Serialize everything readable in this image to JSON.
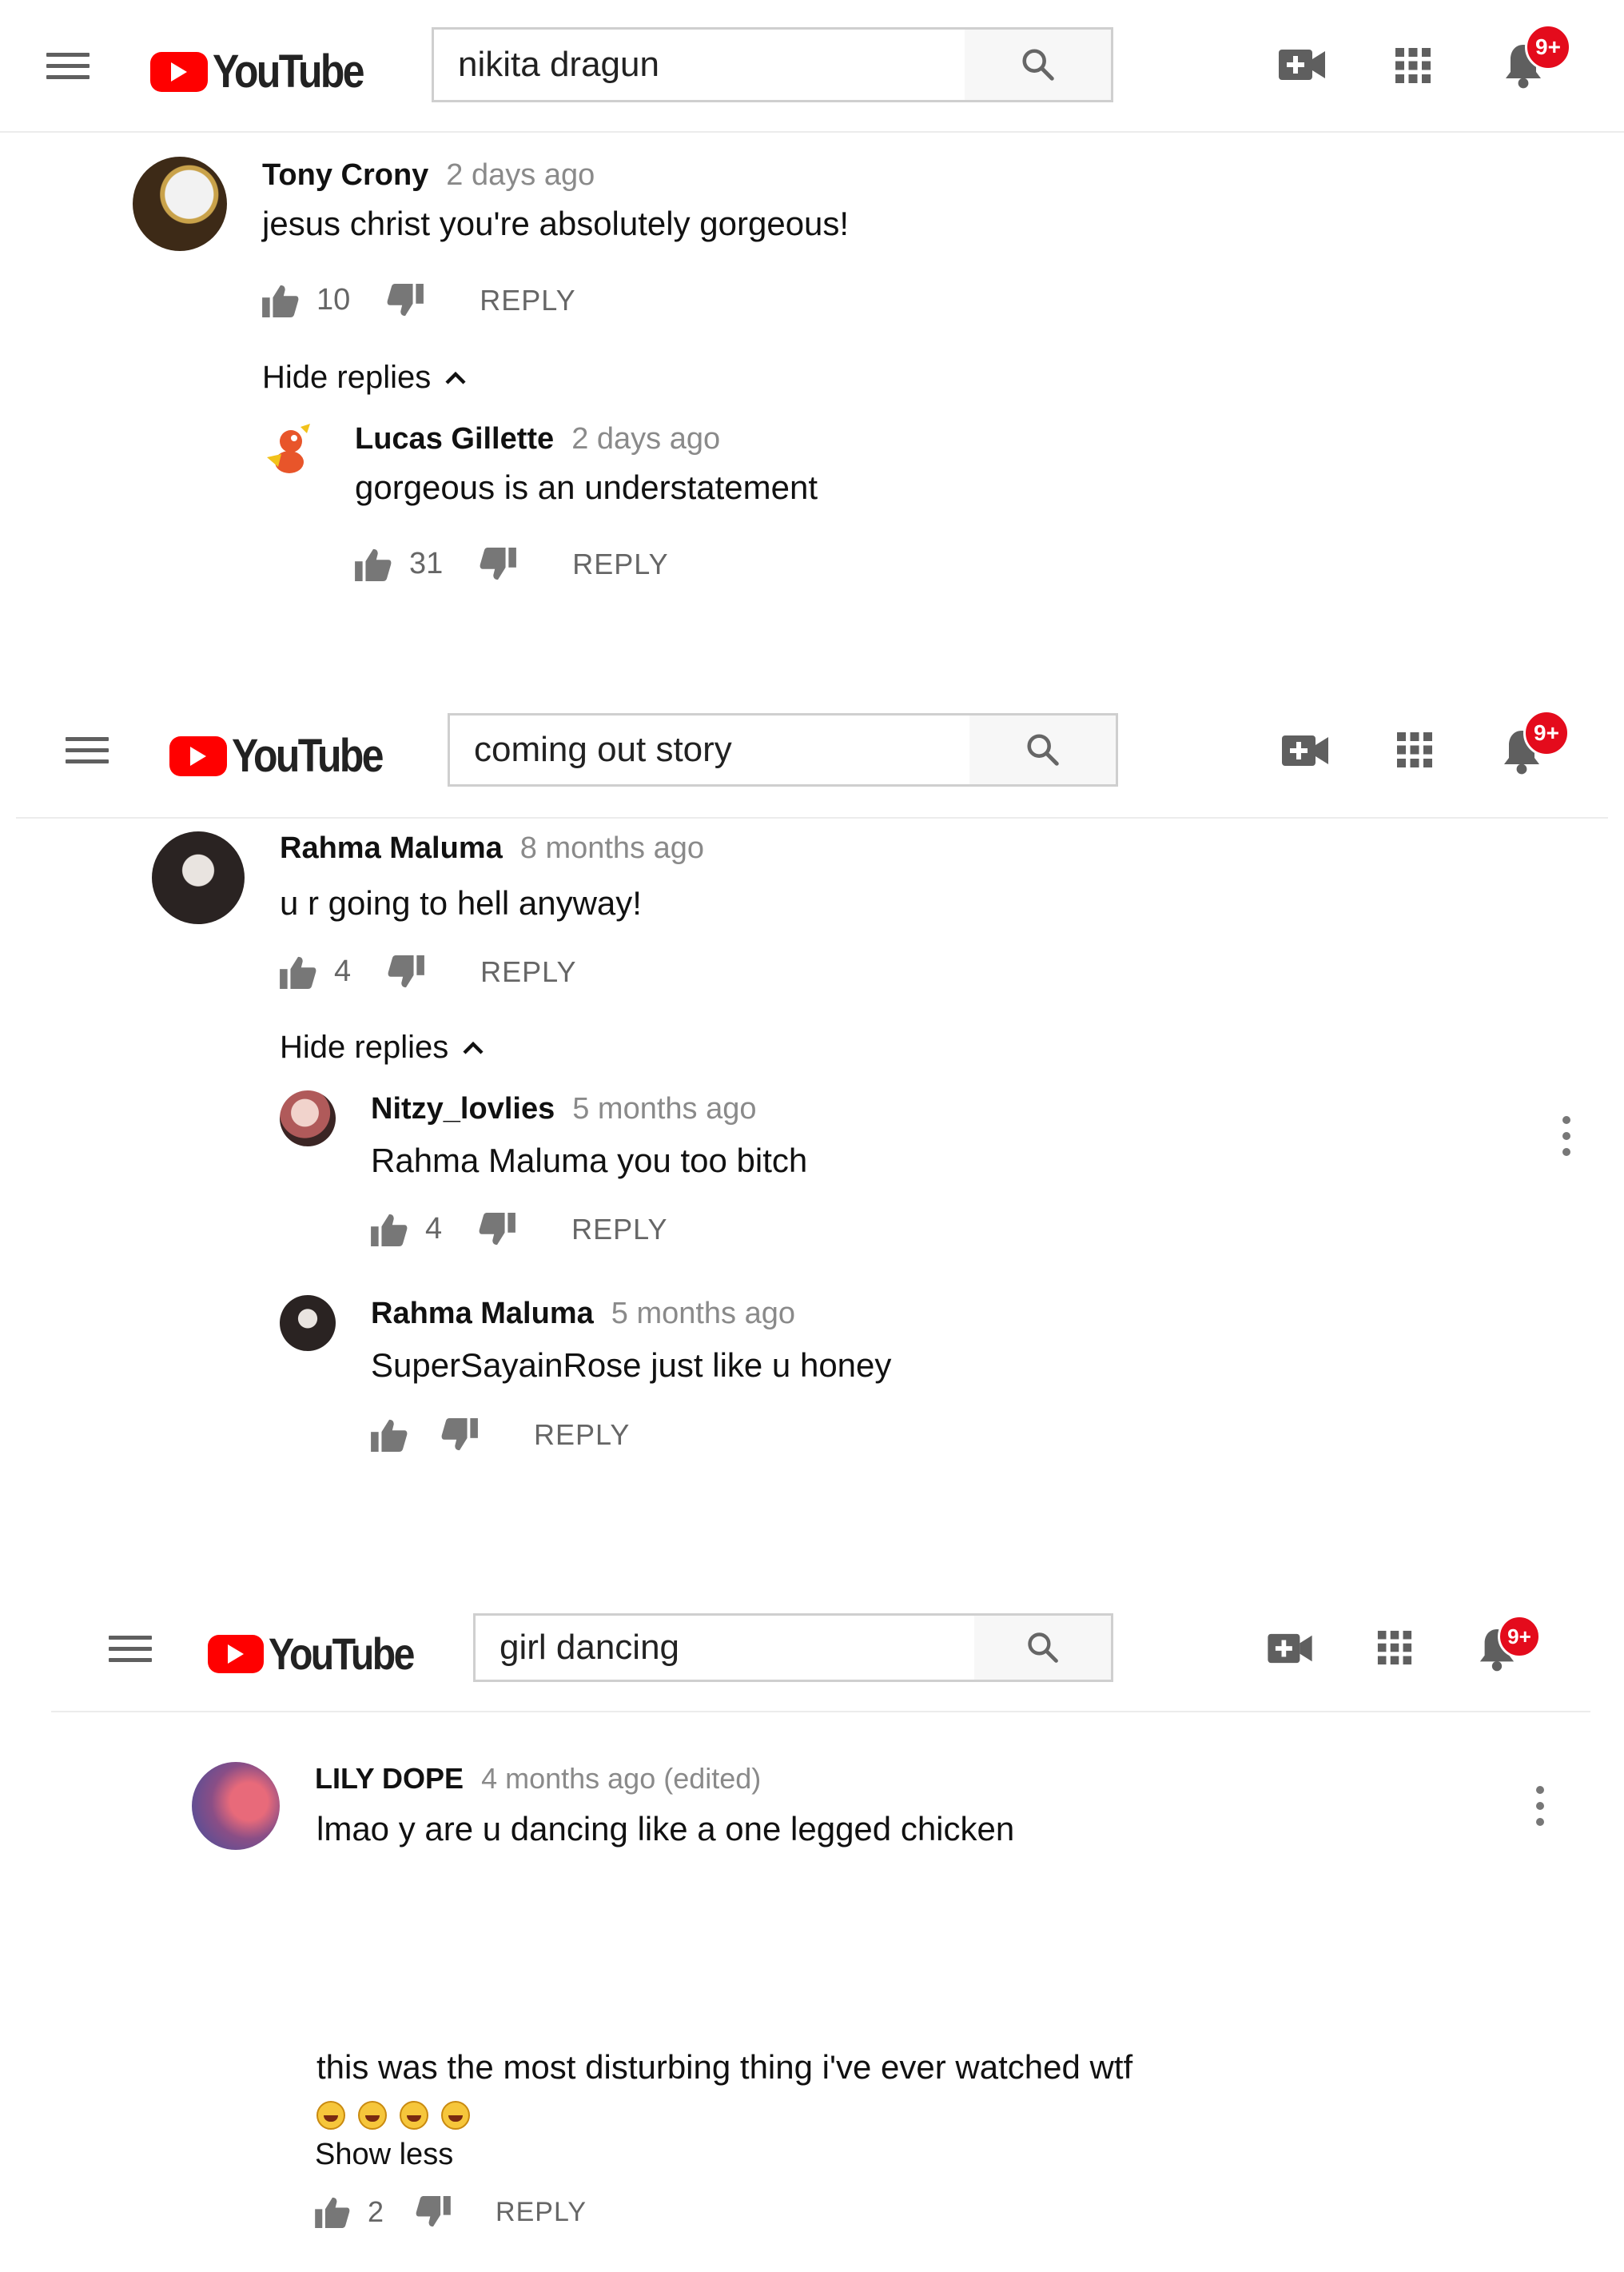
{
  "app_name": "YouTube",
  "panels": [
    {
      "search_query": "nikita dragun",
      "notification_badge": "9+",
      "comment": {
        "author": "Tony Crony",
        "time": "2 days ago",
        "text": "jesus christ you're absolutely gorgeous!",
        "likes": "10",
        "reply_label": "REPLY",
        "avatar_icon": "eagle-avatar"
      },
      "hide_replies_label": "Hide replies",
      "replies": [
        {
          "author": "Lucas Gillette",
          "time": "2 days ago",
          "text": "gorgeous is an understatement",
          "likes": "31",
          "reply_label": "REPLY",
          "avatar_icon": "cartoon-avatar"
        }
      ]
    },
    {
      "search_query": "coming out story",
      "notification_badge": "9+",
      "comment": {
        "author": "Rahma Maluma",
        "time": "8 months ago",
        "text": "u r going to hell anyway!",
        "likes": "4",
        "reply_label": "REPLY",
        "avatar_icon": "person-avatar"
      },
      "hide_replies_label": "Hide replies",
      "replies": [
        {
          "author": "Nitzy_lovlies",
          "time": "5 months ago",
          "text": "Rahma Maluma you too bitch",
          "likes": "4",
          "reply_label": "REPLY",
          "avatar_icon": "person-avatar"
        },
        {
          "author": "Rahma Maluma",
          "time": "5 months ago",
          "text": "SuperSayainRose just like u honey",
          "likes": "",
          "reply_label": "REPLY",
          "avatar_icon": "person-avatar"
        }
      ]
    },
    {
      "search_query": "girl dancing",
      "notification_badge": "9+",
      "comment": {
        "author": "LILY DOPE",
        "time": "4 months ago (edited)",
        "text": "lmao y are u dancing like a one legged chicken",
        "text_2": "this was the most disturbing thing i've ever watched wtf",
        "emojis": [
          "laughing-emoji",
          "laughing-emoji",
          "laughing-emoji",
          "grimacing-emoji"
        ],
        "show_less_label": "Show less",
        "likes": "2",
        "reply_label": "REPLY",
        "avatar_icon": "gradient-avatar"
      }
    }
  ],
  "colors": {
    "brand_red": "#ff0000",
    "badge_red": "#e40b1c",
    "secondary_text": "#8a8a8a",
    "icon_gray": "#5f5f5f"
  }
}
